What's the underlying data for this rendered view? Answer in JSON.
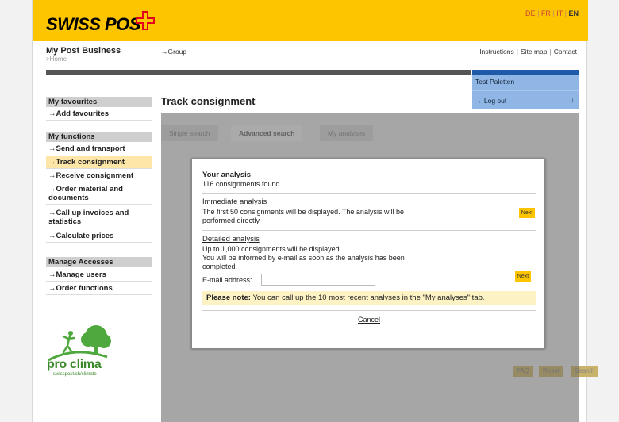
{
  "header": {
    "logo_text": "SWISS POST",
    "languages": [
      "DE",
      "FR",
      "IT",
      "EN"
    ],
    "active_language": "EN",
    "brand_color": "#fdc500"
  },
  "nav": {
    "business_title": "My Post Business",
    "breadcrumb": ">Home",
    "group_link": "→Group",
    "links": [
      "Instructions",
      "Site map",
      "Contact"
    ]
  },
  "user": {
    "name": "Test Paletten",
    "logout": "→ Log out",
    "logout_arrow": "↓"
  },
  "sidebar": {
    "favourites_head": "My favourites",
    "favourites": [
      "→Add favourites"
    ],
    "functions_head": "My functions",
    "functions": [
      "→Send and transport",
      "→Track consignment",
      "→Receive consignment",
      "→Order material and documents",
      "→Call up invoices and statistics",
      "→Calculate prices"
    ],
    "active_function": "→Track consignment",
    "access_head": "Manage Accesses",
    "access": [
      "→Manage users",
      "→Order functions"
    ]
  },
  "main": {
    "title": "Track consignment",
    "tabs": [
      "Single search",
      "Advanced search",
      "My analyses"
    ],
    "active_tab": "Advanced search",
    "bottom_buttons": [
      "FAQ",
      "Reset",
      "Search"
    ]
  },
  "dialog": {
    "title": "Your analysis",
    "found": "116 consignments found.",
    "immediate_head": "Immediate analysis",
    "immediate_text_1": "The first 50 consignments will be displayed. The analysis will be",
    "immediate_text_2": "performed directly.",
    "next_label": "Next",
    "detailed_head": "Detailed analysis",
    "detailed_text_1": "Up to 1,000 consignments will be displayed.",
    "detailed_text_2": "You will be informed by e-mail as soon as the analysis has been",
    "detailed_text_3": "completed.",
    "email_label": "E-mail address:",
    "email_value": "",
    "note_label": "Please note:",
    "note_text": "You can call up the 10 most recent analyses in the \"My analyses\" tab.",
    "cancel_label": "Cancel"
  },
  "proclima": {
    "text": "pro clima",
    "sub": "swisspost.ch/climate"
  }
}
